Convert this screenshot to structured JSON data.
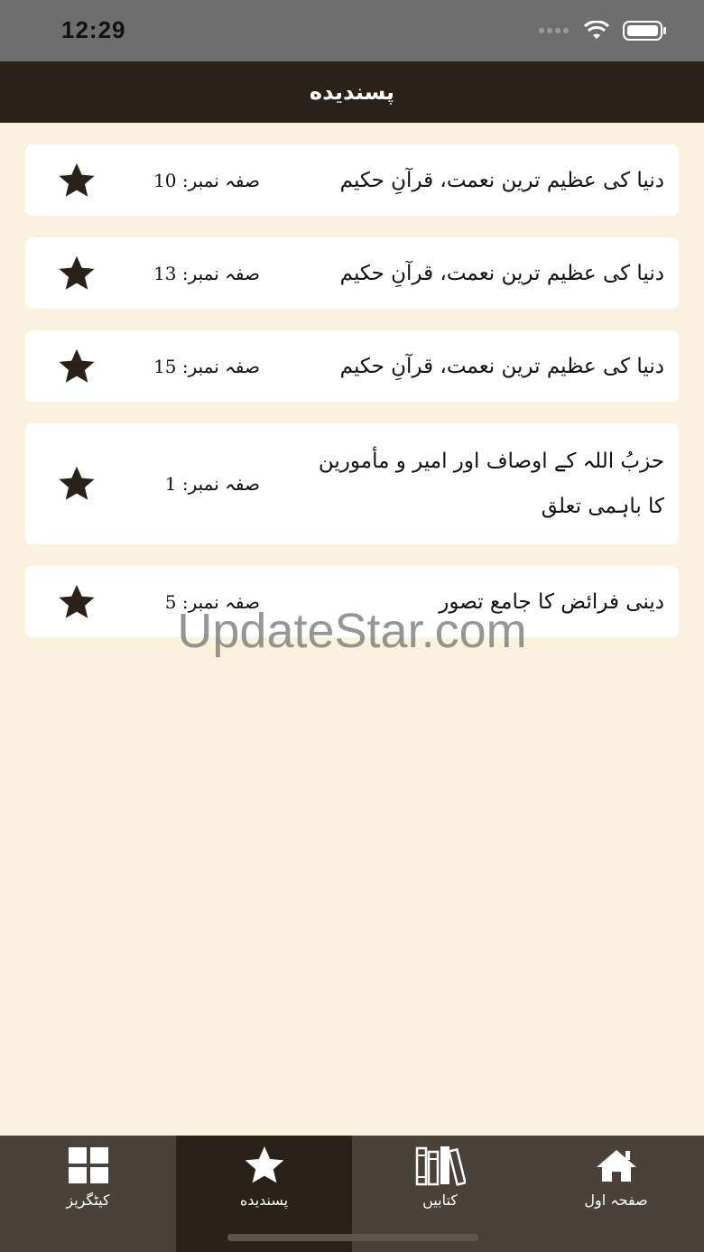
{
  "status": {
    "time": "12:29"
  },
  "nav": {
    "title": "پسندیده"
  },
  "favorites": [
    {
      "title": "دنیا کی عظیم ترین نعمت، قرآنِ حکیم",
      "page": "صفہ نمبر: 10"
    },
    {
      "title": "دنیا کی عظیم ترین نعمت، قرآنِ حکیم",
      "page": "صفہ نمبر: 13"
    },
    {
      "title": "دنیا کی عظیم ترین نعمت، قرآنِ حکیم",
      "page": "صفہ نمبر: 15"
    },
    {
      "title": "حزبُ اللہ کے اوصاف اور امیر و مأمورین کا باہمی تعلق",
      "page": "صفہ نمبر: 1"
    },
    {
      "title": "دینی فرائض کا جامع تصور",
      "page": "صفہ نمبر: 5"
    }
  ],
  "watermark": "UpdateStar.com",
  "tabs": [
    {
      "label": "کیٹگریز",
      "icon": "grid-icon"
    },
    {
      "label": "پسندیده",
      "icon": "star-icon"
    },
    {
      "label": "کتابیں",
      "icon": "books-icon"
    },
    {
      "label": "صفحہ اول",
      "icon": "home-icon"
    }
  ],
  "colors": {
    "header": "#2a2118",
    "background": "#faf2dc",
    "tabbar": "#4a423a"
  }
}
